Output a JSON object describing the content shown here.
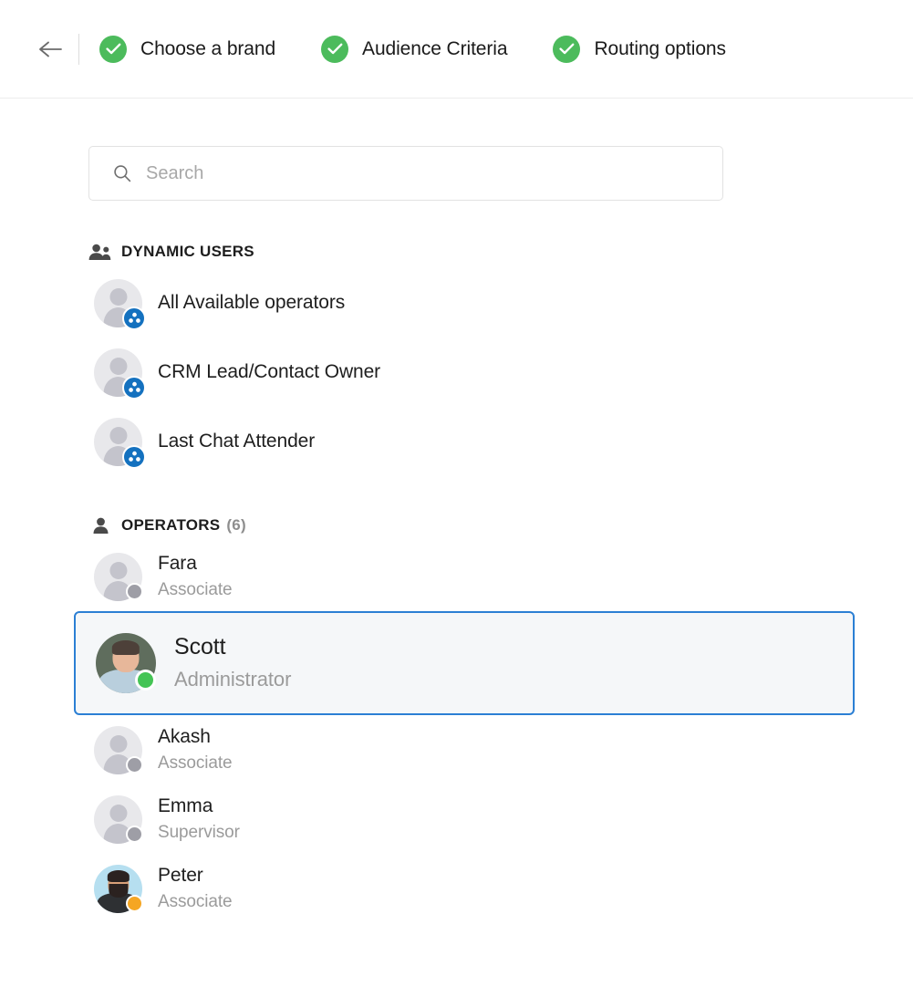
{
  "header": {
    "back_icon": "arrow-left-icon",
    "steps": [
      {
        "label": "Choose a brand",
        "icon": "check-circle-icon",
        "completed": true
      },
      {
        "label": "Audience Criteria",
        "icon": "check-circle-icon",
        "completed": true
      },
      {
        "label": "Routing options",
        "icon": "check-circle-icon",
        "completed": true
      }
    ]
  },
  "search": {
    "icon": "search-icon",
    "placeholder": "Search",
    "value": ""
  },
  "sections": [
    {
      "id": "dynamic-users",
      "title": "DYNAMIC USERS",
      "count": "",
      "icon": "people-icon",
      "items": [
        {
          "name": "All Available operators",
          "avatar": "placeholder",
          "badge": "dynamic-badge-icon"
        },
        {
          "name": "CRM Lead/Contact Owner",
          "avatar": "placeholder",
          "badge": "dynamic-badge-icon"
        },
        {
          "name": "Last Chat Attender",
          "avatar": "placeholder",
          "badge": "dynamic-badge-icon"
        }
      ]
    },
    {
      "id": "operators",
      "title": "OPERATORS",
      "count": "(6)",
      "icon": "person-icon",
      "items": [
        {
          "name": "Fara",
          "role": "Associate",
          "avatar": "placeholder",
          "status": "offline",
          "selected": false
        },
        {
          "name": "Scott",
          "role": "Administrator",
          "avatar": "photo-scott",
          "status": "online",
          "selected": true
        },
        {
          "name": "Akash",
          "role": "Associate",
          "avatar": "placeholder",
          "status": "offline",
          "selected": false
        },
        {
          "name": "Emma",
          "role": "Supervisor",
          "avatar": "placeholder",
          "status": "offline",
          "selected": false
        },
        {
          "name": "Peter",
          "role": "Associate",
          "avatar": "photo-peter",
          "status": "away",
          "selected": false
        }
      ]
    }
  ],
  "colors": {
    "step_complete": "#4cbb5c",
    "selection_border": "#2b7fd4",
    "selection_fill": "#f5f7f9",
    "badge_blue": "#1471bf",
    "status_online": "#44c455",
    "status_away": "#f5a623",
    "status_offline": "#9e9ea6"
  }
}
